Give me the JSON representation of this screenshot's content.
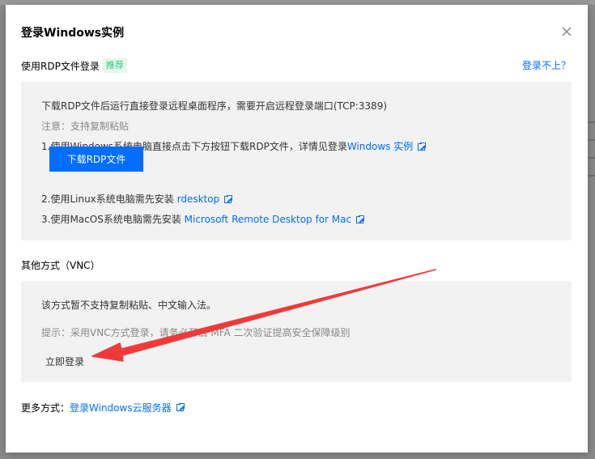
{
  "dialog": {
    "title": "登录Windows实例",
    "close_label": "×"
  },
  "rdp": {
    "heading": "使用RDP文件登录",
    "badge": "推荐",
    "help_link": "登录不上？",
    "intro": "下载RDP文件后运行直接登录远程桌面程序，需要开启远程登录端口(TCP:3389)",
    "note": "注意：支持复制粘贴",
    "step1_text": "1.使用Windows系统电脑直接点击下方按钮下载RDP文件，详情见登录",
    "step1_link": "Windows 实例",
    "download_button": "下载RDP文件",
    "step2_text": "2.使用Linux系统电脑需先安装 ",
    "step2_link": "rdesktop",
    "step3_text": "3.使用MacOS系统电脑需先安装 ",
    "step3_link": "Microsoft Remote Desktop for Mac"
  },
  "vnc": {
    "heading": "其他方式（VNC）",
    "desc": "该方式暂不支持复制粘贴、中文输入法。",
    "tip": "提示：采用VNC方式登录，请务必开启 MFA 二次验证提高安全保障级别",
    "login_link": "立即登录"
  },
  "more": {
    "label": "更多方式：",
    "link": "登录Windows云服务器"
  },
  "colors": {
    "accent": "#006eff",
    "annotation_arrow": "#f03a3a",
    "badge_text": "#29cc85",
    "panel_bg": "#f2f2f2"
  }
}
